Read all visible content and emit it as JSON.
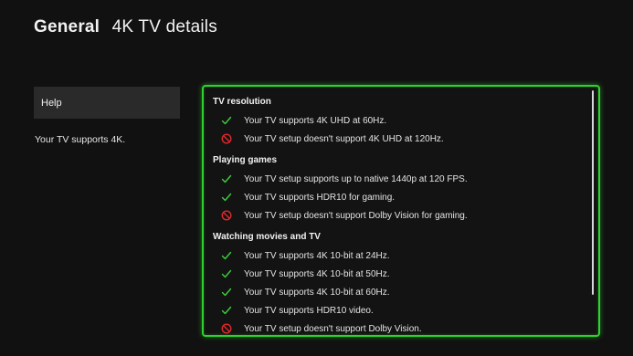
{
  "header": {
    "section": "General",
    "page": "4K TV details"
  },
  "sidebar": {
    "help_label": "Help",
    "summary": "Your TV supports 4K."
  },
  "colors": {
    "accent": "#2fd12f",
    "supported": "#3ccf3c",
    "unsupported": "#e0282b"
  },
  "groups": [
    {
      "title": "TV resolution",
      "items": [
        {
          "status": "check-icon",
          "text": "Your TV supports 4K UHD at 60Hz."
        },
        {
          "status": "blocked-icon",
          "text": "Your TV setup doesn't support 4K UHD at 120Hz."
        }
      ]
    },
    {
      "title": "Playing games",
      "items": [
        {
          "status": "check-icon",
          "text": "Your TV setup supports up to native 1440p at 120 FPS."
        },
        {
          "status": "check-icon",
          "text": "Your TV supports HDR10 for gaming."
        },
        {
          "status": "blocked-icon",
          "text": "Your TV setup doesn't support Dolby Vision for gaming."
        }
      ]
    },
    {
      "title": "Watching movies and TV",
      "items": [
        {
          "status": "check-icon",
          "text": "Your TV supports 4K 10-bit at 24Hz."
        },
        {
          "status": "check-icon",
          "text": "Your TV supports 4K 10-bit at 50Hz."
        },
        {
          "status": "check-icon",
          "text": "Your TV supports 4K 10-bit at 60Hz."
        },
        {
          "status": "check-icon",
          "text": "Your TV supports HDR10 video."
        },
        {
          "status": "blocked-icon",
          "text": "Your TV setup doesn't support Dolby Vision."
        }
      ]
    }
  ]
}
